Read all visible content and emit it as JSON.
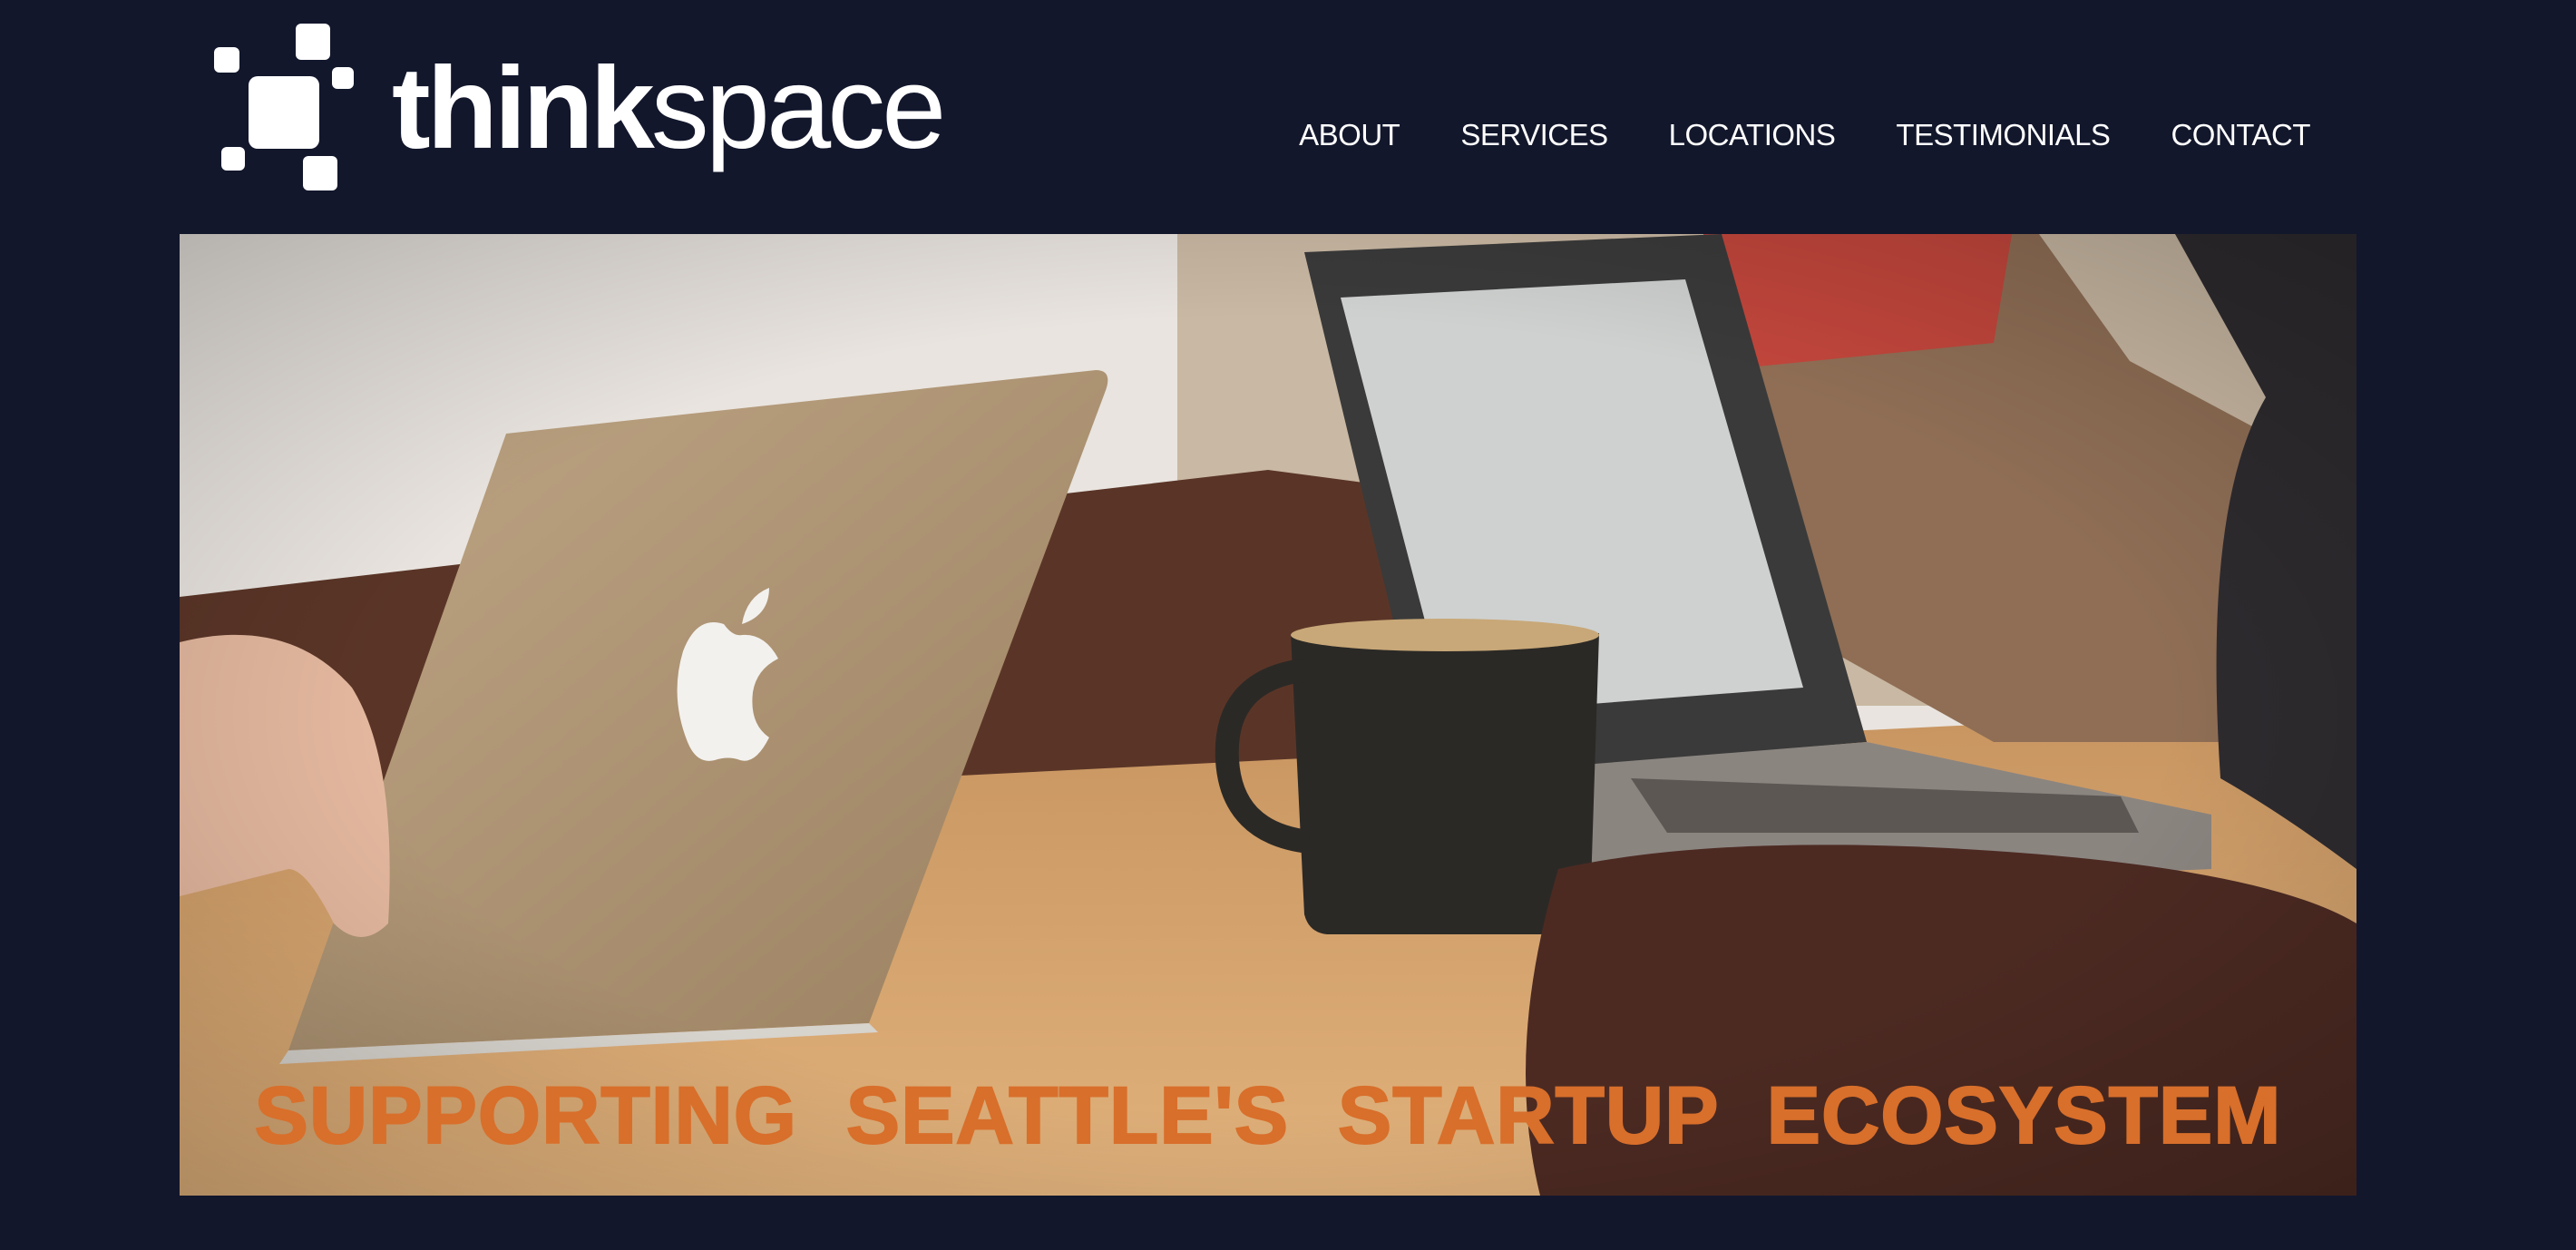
{
  "brand": {
    "name_bold": "think",
    "name_light": "space",
    "logo_color": "#ffffff"
  },
  "nav": {
    "items": [
      "ABOUT",
      "SERVICES",
      "LOCATIONS",
      "TESTIMONIALS",
      "CONTACT"
    ]
  },
  "hero": {
    "tagline": "SUPPORTING SEATTLE'S STARTUP ECOSYSTEM",
    "tagline_color": "#d86f2b",
    "image_description_icon": "coworking-photo"
  },
  "colors": {
    "background": "#12172c",
    "accent": "#d86f2b"
  }
}
